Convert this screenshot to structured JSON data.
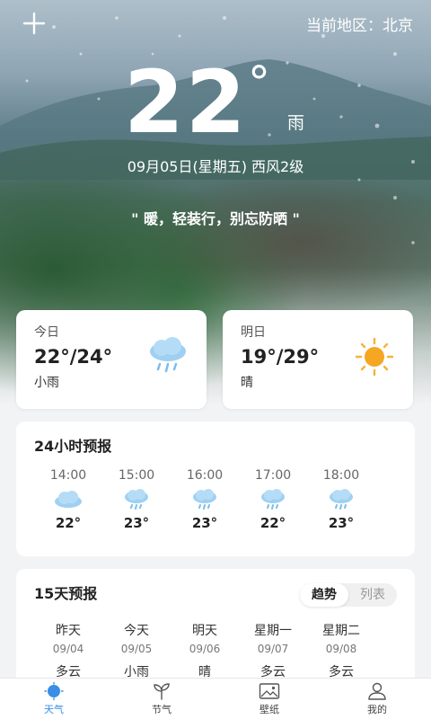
{
  "header": {
    "add_icon": "plus-icon",
    "region_label": "当前地区：北京"
  },
  "current": {
    "temperature": "22",
    "degree_symbol": "°",
    "condition": "雨",
    "date_line": "09月05日(星期五) 西风2级",
    "tip": "\" 暖，轻装行，别忘防晒 \""
  },
  "today": {
    "label": "今日",
    "temp_range": "22°/24°",
    "condition": "小雨",
    "icon": "rain-cloud-icon"
  },
  "tomorrow": {
    "label": "明日",
    "temp_range": "19°/29°",
    "condition": "晴",
    "icon": "sun-icon"
  },
  "hourly": {
    "title": "24小时预报",
    "items": [
      {
        "time": "14:00",
        "temp": "22°",
        "icon": "cloud-icon"
      },
      {
        "time": "15:00",
        "temp": "23°",
        "icon": "rain-cloud-icon"
      },
      {
        "time": "16:00",
        "temp": "23°",
        "icon": "rain-cloud-icon"
      },
      {
        "time": "17:00",
        "temp": "22°",
        "icon": "rain-cloud-icon"
      },
      {
        "time": "18:00",
        "temp": "23°",
        "icon": "rain-cloud-icon"
      }
    ]
  },
  "fifteen_day": {
    "title": "15天预报",
    "toggle": {
      "trend": "趋势",
      "list": "列表"
    },
    "days": [
      {
        "name": "昨天",
        "date": "09/04",
        "condition": "多云"
      },
      {
        "name": "今天",
        "date": "09/05",
        "condition": "小雨"
      },
      {
        "name": "明天",
        "date": "09/06",
        "condition": "晴"
      },
      {
        "name": "星期一",
        "date": "09/07",
        "condition": "多云"
      },
      {
        "name": "星期二",
        "date": "09/08",
        "condition": "多云"
      }
    ]
  },
  "nav": {
    "items": [
      {
        "label": "天气",
        "icon": "sun-icon",
        "active": true
      },
      {
        "label": "节气",
        "icon": "sprout-icon",
        "active": false
      },
      {
        "label": "壁纸",
        "icon": "image-icon",
        "active": false
      },
      {
        "label": "我的",
        "icon": "user-icon",
        "active": false
      }
    ]
  },
  "colors": {
    "accent": "#3a8ee6",
    "sun": "#f5a623",
    "rain": "#8fc7ef"
  }
}
